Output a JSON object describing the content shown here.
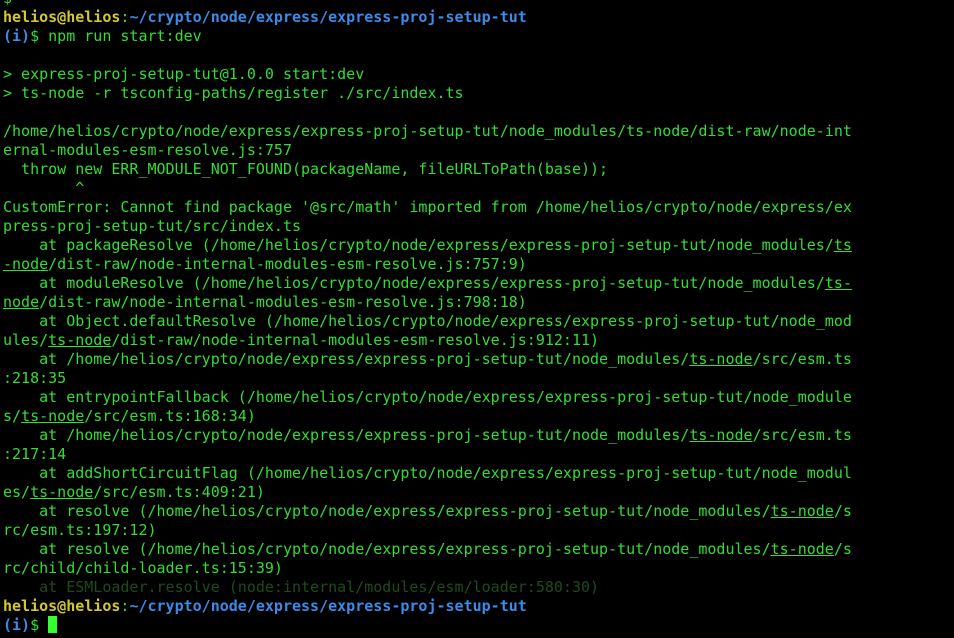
{
  "window": {
    "top_cut_text": "$"
  },
  "prompt": {
    "user_host": "helios@helios",
    "sep": ":",
    "path": "~/crypto/node/express/express-proj-setup-tut",
    "indicator": "(i)",
    "symbol": "$",
    "command": " npm run start:dev"
  },
  "output": [
    "",
    "> express-proj-setup-tut@1.0.0 start:dev",
    "> ts-node -r tsconfig-paths/register ./src/index.ts",
    "",
    "/home/helios/crypto/node/express/express-proj-setup-tut/node_modules/ts-node/dist-raw/node-int",
    "ernal-modules-esm-resolve.js:757",
    "  throw new ERR_MODULE_NOT_FOUND(packageName, fileURLToPath(base));",
    "        ^",
    "CustomError: Cannot find package '@src/math' imported from /home/helios/crypto/node/express/ex",
    "press-proj-setup-tut/src/index.ts"
  ],
  "stack": [
    {
      "pre": "    at packageResolve (/home/helios/crypto/node/express/express-proj-setup-tut/node_modules/",
      "link": "ts",
      "post": ""
    },
    {
      "pre": "",
      "link": "-node",
      "post": "/dist-raw/node-internal-modules-esm-resolve.js:757:9)"
    },
    {
      "pre": "    at moduleResolve (/home/helios/crypto/node/express/express-proj-setup-tut/node_modules/",
      "link": "ts-",
      "post": ""
    },
    {
      "pre": "",
      "link": "node",
      "post": "/dist-raw/node-internal-modules-esm-resolve.js:798:18)"
    },
    {
      "pre": "    at Object.defaultResolve (/home/helios/crypto/node/express/express-proj-setup-tut/node_mod",
      "link": "",
      "post": "ules/"
    },
    {
      "pre": "ules/",
      "link": "ts-node",
      "post": "/dist-raw/node-internal-modules-esm-resolve.js:912:11)"
    },
    {
      "pre": "    at /home/helios/crypto/node/express/express-proj-setup-tut/node_modules/",
      "link": "ts-node",
      "post": "/src/esm.ts"
    },
    {
      "pre": ":218:35",
      "link": "",
      "post": ""
    },
    {
      "pre": "    at entrypointFallback (/home/helios/crypto/node/express/express-proj-setup-tut/node_module",
      "link": "",
      "post": ""
    },
    {
      "pre": "s/",
      "link": "ts-node",
      "post": "/src/esm.ts:168:34)"
    },
    {
      "pre": "    at /home/helios/crypto/node/express/express-proj-setup-tut/node_modules/",
      "link": "ts-node",
      "post": "/src/esm.ts"
    },
    {
      "pre": ":217:14",
      "link": "",
      "post": ""
    },
    {
      "pre": "    at addShortCircuitFlag (/home/helios/crypto/node/express/express-proj-setup-tut/node_modul",
      "link": "",
      "post": ""
    },
    {
      "pre": "es/",
      "link": "ts-node",
      "post": "/src/esm.ts:409:21)"
    },
    {
      "pre": "    at resolve (/home/helios/crypto/node/express/express-proj-setup-tut/node_modules/",
      "link": "ts-node",
      "post": "/s"
    },
    {
      "pre": "rc/esm.ts:197:12)",
      "link": "",
      "post": ""
    },
    {
      "pre": "    at resolve (/home/helios/crypto/node/express/express-proj-setup-tut/node_modules/",
      "link": "ts-node",
      "post": "/s"
    },
    {
      "pre": "rc/child/child-loader.ts:15:39)",
      "link": "",
      "post": ""
    }
  ],
  "faded_line": "    at ESMLoader.resolve (node:internal/modules/esm/loader:580:30)",
  "colors": {
    "background": "#000000",
    "output_green": "#33dd33",
    "user_yellow": "#d4c830",
    "path_blue": "#3b8be8"
  }
}
